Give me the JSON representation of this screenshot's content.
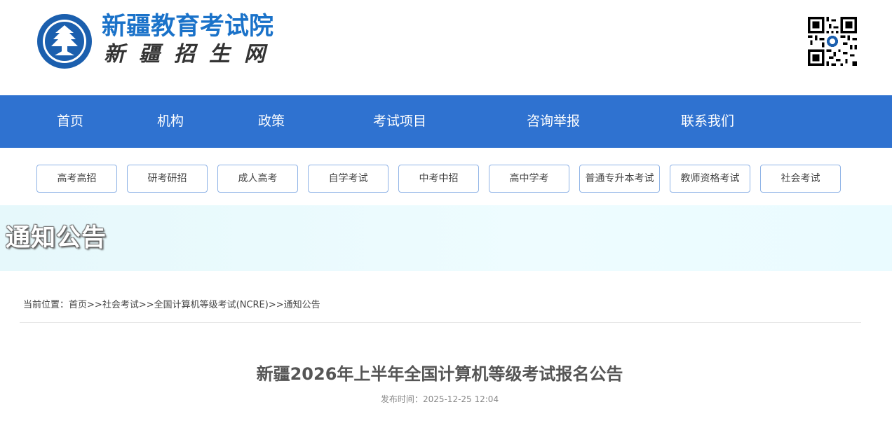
{
  "header": {
    "title": "新疆教育考试院",
    "subtitle": "新疆招生网"
  },
  "colors": {
    "brand_blue": "#1a72c9",
    "nav_bg": "#2f72d0",
    "banner_bg": "#eafbff",
    "button_border": "#8fb3e6"
  },
  "nav": {
    "items": [
      {
        "label": "首页"
      },
      {
        "label": "机构"
      },
      {
        "label": "政策"
      },
      {
        "label": "考试项目"
      },
      {
        "label": "咨询举报"
      },
      {
        "label": "联系我们"
      }
    ]
  },
  "categories": [
    {
      "label": "高考高招"
    },
    {
      "label": "研考研招"
    },
    {
      "label": "成人高考"
    },
    {
      "label": "自学考试"
    },
    {
      "label": "中考中招"
    },
    {
      "label": "高中学考"
    },
    {
      "label": "普通专升本考试"
    },
    {
      "label": "教师资格考试"
    },
    {
      "label": "社会考试"
    }
  ],
  "banner": {
    "title": "通知公告"
  },
  "breadcrumb": {
    "prefix": "当前位置：",
    "items": [
      "首页",
      "社会考试",
      "全国计算机等级考试(NCRE)",
      "通知公告"
    ],
    "separator": ">>"
  },
  "article": {
    "title": "新疆2026年上半年全国计算机等级考试报名公告",
    "publish_label": "发布时间：",
    "publish_time": "2025-12-25 12:04"
  },
  "icons": {
    "logo": "emblem-logo-icon",
    "qr": "qr-code-icon"
  }
}
